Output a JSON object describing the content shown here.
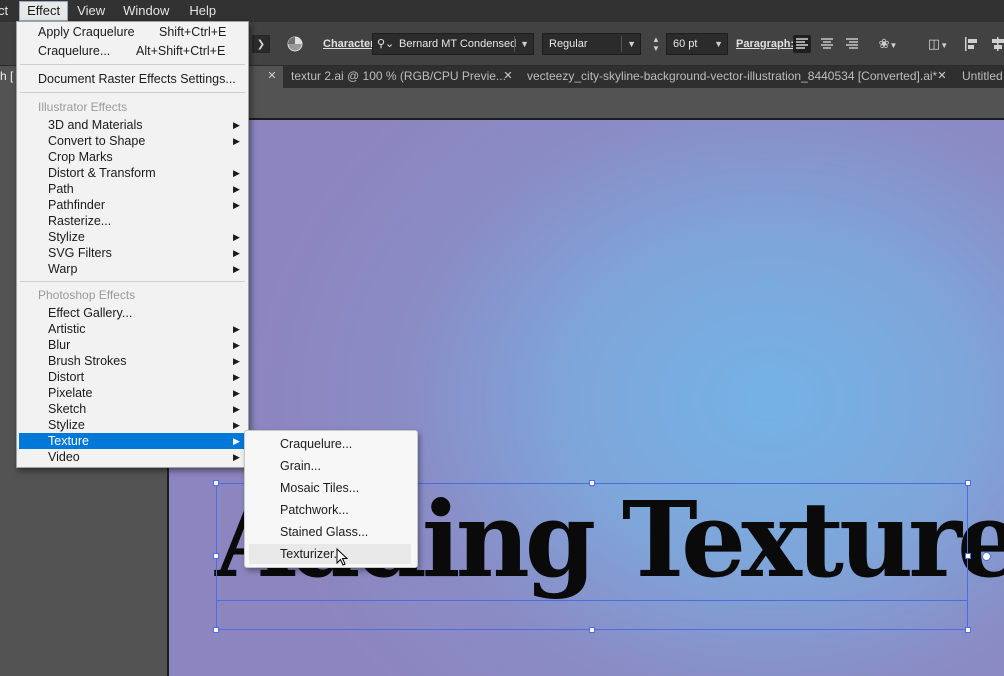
{
  "menubar": {
    "items": [
      "ct",
      "Effect",
      "View",
      "Window",
      "Help"
    ],
    "active": "Effect"
  },
  "controlbar": {
    "character_label": "Character:",
    "font_family": "Bernard MT Condensed",
    "font_style": "Regular",
    "font_size": "60 pt",
    "paragraph_label": "Paragraph:"
  },
  "tabs": [
    {
      "label": "h [",
      "active": true
    },
    {
      "label": "textur 2.ai @ 100 % (RGB/CPU Previe...",
      "active": false
    },
    {
      "label": "vecteezy_city-skyline-background-vector-illustration_8440534 [Converted].ai*",
      "active": false
    },
    {
      "label": "Untitled",
      "active": false
    }
  ],
  "effect_menu": {
    "top_items": [
      {
        "label": "Apply Craquelure",
        "shortcut": "Shift+Ctrl+E"
      },
      {
        "label": "Craquelure...",
        "shortcut": "Alt+Shift+Ctrl+E"
      }
    ],
    "document_raster": "Document Raster Effects Settings...",
    "illustrator_header": "Illustrator Effects",
    "illustrator_items": [
      {
        "label": "3D and Materials",
        "sub": true
      },
      {
        "label": "Convert to Shape",
        "sub": true
      },
      {
        "label": "Crop Marks",
        "sub": false
      },
      {
        "label": "Distort & Transform",
        "sub": true
      },
      {
        "label": "Path",
        "sub": true
      },
      {
        "label": "Pathfinder",
        "sub": true
      },
      {
        "label": "Rasterize...",
        "sub": false
      },
      {
        "label": "Stylize",
        "sub": true
      },
      {
        "label": "SVG Filters",
        "sub": true
      },
      {
        "label": "Warp",
        "sub": true
      }
    ],
    "photoshop_header": "Photoshop Effects",
    "photoshop_items": [
      {
        "label": "Effect Gallery...",
        "sub": false
      },
      {
        "label": "Artistic",
        "sub": true
      },
      {
        "label": "Blur",
        "sub": true
      },
      {
        "label": "Brush Strokes",
        "sub": true
      },
      {
        "label": "Distort",
        "sub": true
      },
      {
        "label": "Pixelate",
        "sub": true
      },
      {
        "label": "Sketch",
        "sub": true
      },
      {
        "label": "Stylize",
        "sub": true
      },
      {
        "label": "Texture",
        "sub": true,
        "highlighted": true
      },
      {
        "label": "Video",
        "sub": true
      }
    ]
  },
  "texture_submenu": {
    "items": [
      "Craquelure...",
      "Grain...",
      "Mosaic Tiles...",
      "Patchwork...",
      "Stained Glass...",
      "Texturizer..."
    ],
    "hovered": "Texturizer..."
  },
  "artboard": {
    "text": "Adding Texture"
  },
  "colors": {
    "menu_highlight": "#0078d7",
    "selection": "#4a6ee0"
  }
}
